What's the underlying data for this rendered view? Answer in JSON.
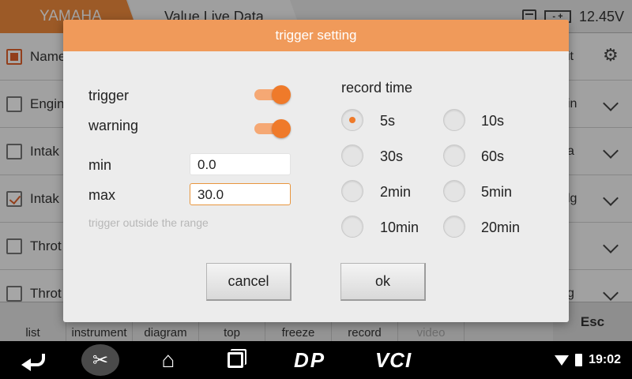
{
  "app": {
    "brand_tab": "YAMAHA",
    "page_tab": "Value Live Data",
    "battery_voltage": "12.45V",
    "battery_icon_text": "- +"
  },
  "list": {
    "header_row": {
      "name": "Name",
      "unit": "it"
    },
    "rows": [
      {
        "name": "Engin",
        "unit": "in"
      },
      {
        "name": "Intak",
        "unit": "a"
      },
      {
        "name": "Intak",
        "unit": "lg"
      },
      {
        "name": "Throt",
        "unit": ""
      },
      {
        "name": "Throt",
        "unit": "g"
      }
    ]
  },
  "toolbar": {
    "items": [
      "list",
      "instrument",
      "diagram",
      "top",
      "freeze",
      "record",
      "video"
    ],
    "esc": "Esc"
  },
  "navbar": {
    "dp_label": "DP",
    "vci_label": "VCI",
    "clock": "19:02"
  },
  "dialog": {
    "title": "trigger setting",
    "trigger_label": "trigger",
    "trigger_on": true,
    "warning_label": "warning",
    "warning_on": true,
    "min_label": "min",
    "min_value": "0.0",
    "max_label": "max",
    "max_value": "30.0",
    "hint": "trigger outside the range",
    "record_time_label": "record time",
    "record_options": [
      "5s",
      "10s",
      "30s",
      "60s",
      "2min",
      "5min",
      "10min",
      "20min"
    ],
    "selected_record": "5s",
    "cancel_label": "cancel",
    "ok_label": "ok"
  },
  "colors": {
    "accent": "#ef7a2a",
    "title_bar": "#f09a5a",
    "brand_tab": "#f08a3c"
  },
  "icons": {
    "calendar": "calendar-icon",
    "battery": "battery-icon",
    "settings": "gear-icon",
    "back": "back-arrow-icon",
    "scissors": "scissors-icon",
    "home": "home-icon",
    "recents": "recent-apps-icon",
    "wifi": "wifi-icon"
  }
}
